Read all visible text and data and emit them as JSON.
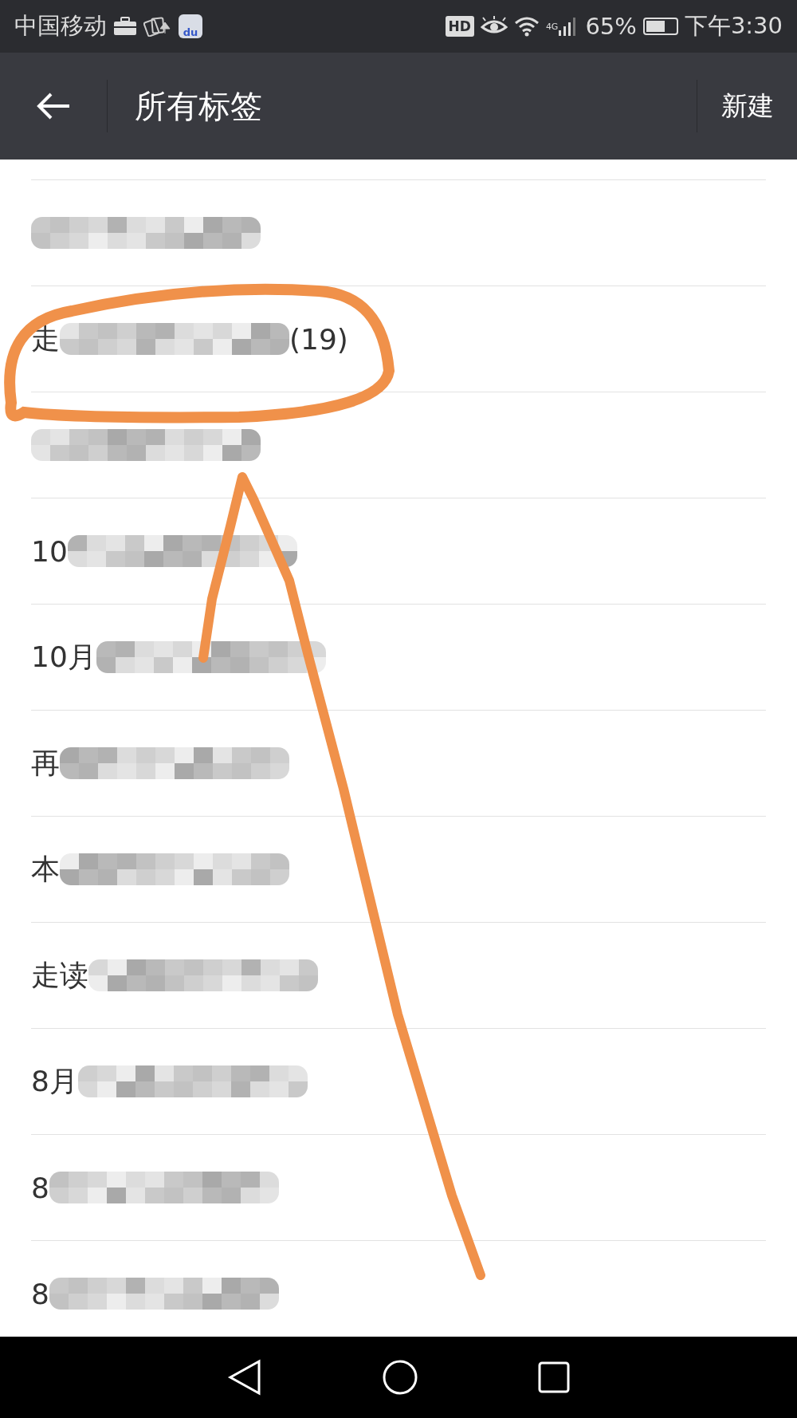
{
  "status_bar": {
    "carrier": "中国移动",
    "app_icon_text": "du",
    "hd_badge": "HD",
    "network": "4G",
    "battery": "65%",
    "time": "下午3:30"
  },
  "toolbar": {
    "title": "所有标签",
    "action": "新建"
  },
  "tags": [
    {
      "parts": [
        {
          "kind": "blur"
        }
      ]
    },
    {
      "parts": [
        {
          "kind": "text",
          "text": "走"
        },
        {
          "kind": "blur"
        },
        {
          "kind": "text",
          "text": "(19)"
        }
      ]
    },
    {
      "parts": [
        {
          "kind": "blur"
        }
      ]
    },
    {
      "parts": [
        {
          "kind": "text",
          "text": "10"
        },
        {
          "kind": "blur"
        }
      ]
    },
    {
      "parts": [
        {
          "kind": "text",
          "text": "10月"
        },
        {
          "kind": "blur"
        }
      ]
    },
    {
      "parts": [
        {
          "kind": "text",
          "text": "再"
        },
        {
          "kind": "blur"
        }
      ]
    },
    {
      "parts": [
        {
          "kind": "text",
          "text": "本"
        },
        {
          "kind": "blur"
        }
      ]
    },
    {
      "parts": [
        {
          "kind": "text",
          "text": "走读"
        },
        {
          "kind": "blur"
        }
      ]
    },
    {
      "parts": [
        {
          "kind": "text",
          "text": "8月"
        },
        {
          "kind": "blur"
        }
      ]
    },
    {
      "parts": [
        {
          "kind": "text",
          "text": "8"
        },
        {
          "kind": "blur"
        }
      ]
    },
    {
      "parts": [
        {
          "kind": "text",
          "text": "8"
        },
        {
          "kind": "blur"
        }
      ]
    }
  ]
}
